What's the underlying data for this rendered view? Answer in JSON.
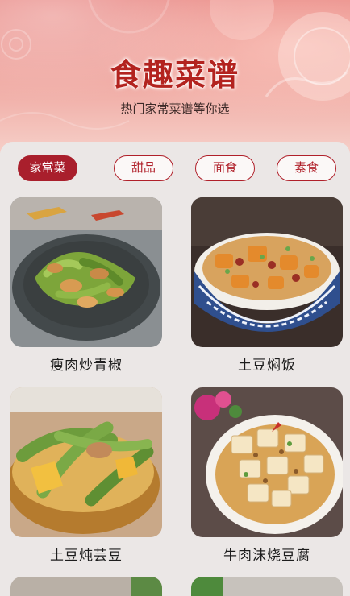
{
  "header": {
    "title": "食趣菜谱",
    "subtitle": "热门家常菜谱等你选"
  },
  "tabs": [
    {
      "label": "家常菜",
      "active": true
    },
    {
      "label": "甜品",
      "active": false
    },
    {
      "label": "面食",
      "active": false
    },
    {
      "label": "素食",
      "active": false
    }
  ],
  "recipes": [
    {
      "name": "瘦肉炒青椒"
    },
    {
      "name": "土豆焖饭"
    },
    {
      "name": "土豆炖芸豆"
    },
    {
      "name": "牛肉沫烧豆腐"
    }
  ],
  "colors": {
    "accent": "#a91f2c",
    "title": "#b3231f",
    "background": "#ebe7e6"
  }
}
